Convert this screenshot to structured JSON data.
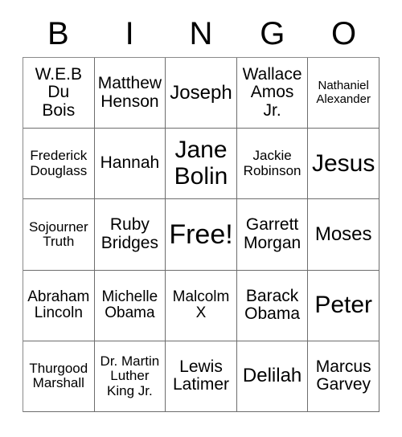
{
  "header": {
    "letters": [
      "B",
      "I",
      "N",
      "G",
      "O"
    ]
  },
  "grid": {
    "rows": [
      [
        {
          "text": "W.E.B\nDu\nBois",
          "size": "fs-l"
        },
        {
          "text": "Matthew\nHenson",
          "size": "fs-l"
        },
        {
          "text": "Joseph",
          "size": "fs-xl"
        },
        {
          "text": "Wallace\nAmos\nJr.",
          "size": "fs-l"
        },
        {
          "text": "Nathaniel\nAlexander",
          "size": "fs-xs"
        }
      ],
      [
        {
          "text": "Frederick\nDouglass",
          "size": "fs-s"
        },
        {
          "text": "Hannah",
          "size": "fs-l"
        },
        {
          "text": "Jane\nBolin",
          "size": "fs-xxl"
        },
        {
          "text": "Jackie\nRobinson",
          "size": "fs-s"
        },
        {
          "text": "Jesus",
          "size": "fs-xxl"
        }
      ],
      [
        {
          "text": "Sojourner\nTruth",
          "size": "fs-s"
        },
        {
          "text": "Ruby\nBridges",
          "size": "fs-l"
        },
        {
          "text": "Free!",
          "size": "fs-huge"
        },
        {
          "text": "Garrett\nMorgan",
          "size": "fs-l"
        },
        {
          "text": "Moses",
          "size": "fs-xl"
        }
      ],
      [
        {
          "text": "Abraham\nLincoln",
          "size": "fs-m"
        },
        {
          "text": "Michelle\nObama",
          "size": "fs-m"
        },
        {
          "text": "Malcolm\nX",
          "size": "fs-m"
        },
        {
          "text": "Barack\nObama",
          "size": "fs-l"
        },
        {
          "text": "Peter",
          "size": "fs-xxl"
        }
      ],
      [
        {
          "text": "Thurgood\nMarshall",
          "size": "fs-s"
        },
        {
          "text": "Dr. Martin\nLuther\nKing Jr.",
          "size": "fs-s"
        },
        {
          "text": "Lewis\nLatimer",
          "size": "fs-l"
        },
        {
          "text": "Delilah",
          "size": "fs-xl"
        },
        {
          "text": "Marcus\nGarvey",
          "size": "fs-l"
        }
      ]
    ]
  },
  "colors": {
    "background": "#ffffff",
    "text": "#000000",
    "grid_line": "#6d6d6d"
  }
}
